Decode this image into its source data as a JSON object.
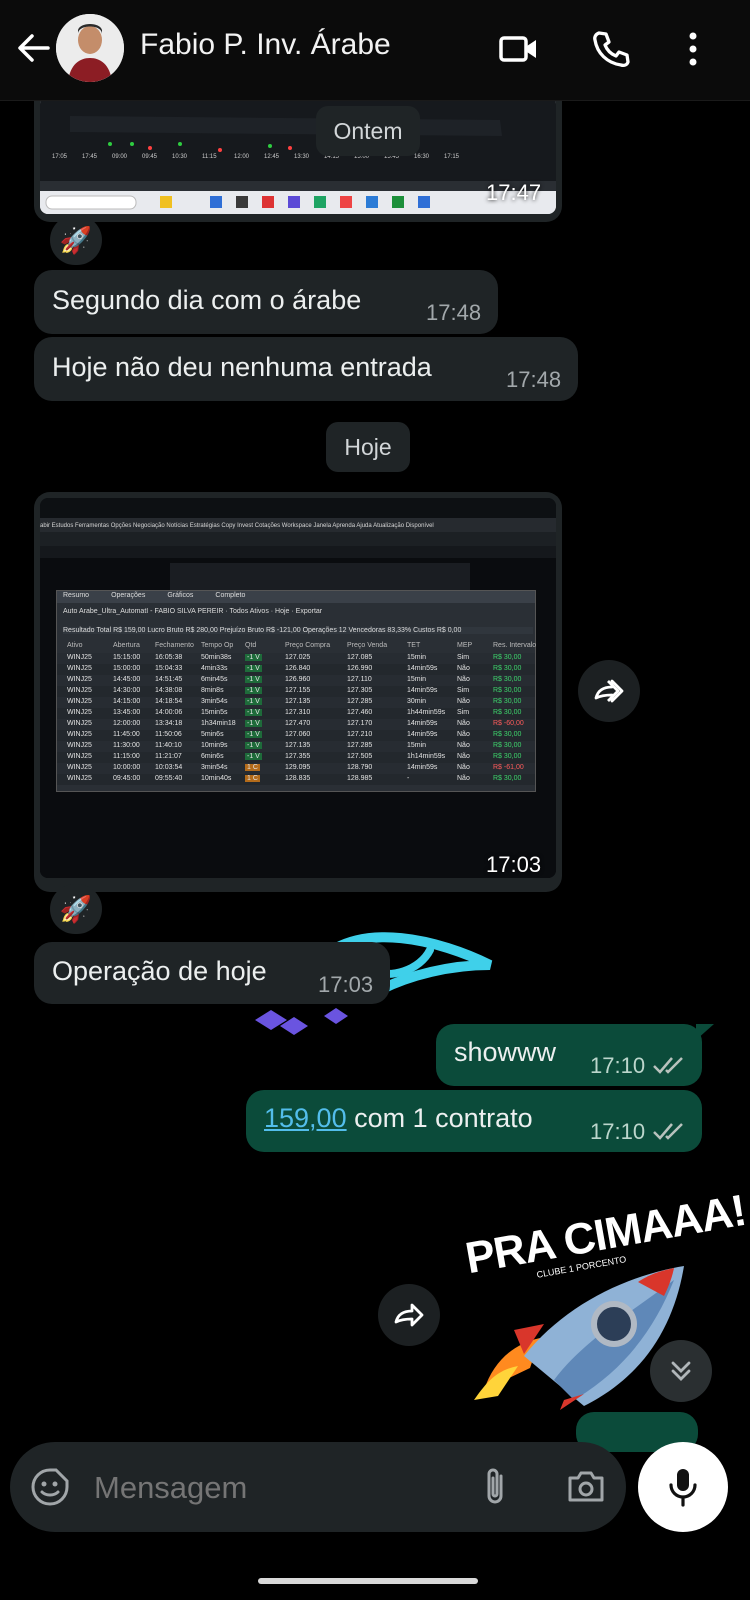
{
  "header": {
    "contact_name": "Fabio P. Inv. Árabe",
    "back_icon": "arrow-left-icon",
    "video_icon": "video-call-icon",
    "call_icon": "phone-icon",
    "menu_icon": "more-vertical-icon"
  },
  "chat": {
    "top_image_time": "17:47",
    "date_divider_yesterday": "Ontem",
    "reaction_1": "🚀",
    "msg1": {
      "text": "Segundo dia com o árabe",
      "time": "17:48"
    },
    "msg2": {
      "text": "Hoje não deu nenhuma entrada",
      "time": "17:48"
    },
    "date_divider_today": "Hoje",
    "image2_time": "17:03",
    "reaction_2": "🚀",
    "msg3": {
      "text": "Operação de hoje",
      "time": "17:03"
    },
    "out1": {
      "text": "showww",
      "time": "17:10"
    },
    "out2": {
      "link": "159,00",
      "text": " com 1 contrato",
      "time": "17:10"
    },
    "sticker": {
      "headline": "PRA CIMAAA!",
      "sub": "CLUBE 1 PORCENTO"
    }
  },
  "screenshot_table": {
    "menu": "abir  Estudos  Ferramentas  Opções  Negociação  Notícias  Estratégias  Copy Invest  Cotações  Workspace  Janela  Aprenda  Ajuda  Atualização Disponível",
    "tabs": [
      "Resumo",
      "Operações",
      "Gráficos",
      "Completo"
    ],
    "filter": "Auto  Arabe_Ultra_AutomatI - FABIO SILVA PEREIR  ·  Todos Ativos  ·  Hoje  ·  Exportar",
    "summary": "Resultado Total R$ 159,00   Lucro Bruto R$ 280,00   Prejuízo Bruto R$ -121,00   Operações 12   Vencedoras 83,33%   Custos R$ 0,00",
    "columns": [
      "Ativo",
      "Abertura",
      "Fechamento",
      "Tempo Op",
      "Qtd",
      "Preço Compra",
      "Preço Venda",
      "TET",
      "MEP",
      "Res. Intervalo"
    ],
    "rows": [
      [
        "WINJ25",
        "15:15:00",
        "16:05:38",
        "50min38s",
        "-1 V",
        "127.025",
        "127.085",
        "15min",
        "Sim",
        "R$ 30,00"
      ],
      [
        "WINJ25",
        "15:00:00",
        "15:04:33",
        "4min33s",
        "-1 V",
        "126.840",
        "126.990",
        "14min59s",
        "Não",
        "R$ 30,00"
      ],
      [
        "WINJ25",
        "14:45:00",
        "14:51:45",
        "6min45s",
        "-1 V",
        "126.960",
        "127.110",
        "15min",
        "Não",
        "R$ 30,00"
      ],
      [
        "WINJ25",
        "14:30:00",
        "14:38:08",
        "8min8s",
        "-1 V",
        "127.155",
        "127.305",
        "14min59s",
        "Sim",
        "R$ 30,00"
      ],
      [
        "WINJ25",
        "14:15:00",
        "14:18:54",
        "3min54s",
        "-1 V",
        "127.135",
        "127.285",
        "30min",
        "Não",
        "R$ 30,00"
      ],
      [
        "WINJ25",
        "13:45:00",
        "14:00:06",
        "15min5s",
        "-1 V",
        "127.310",
        "127.460",
        "1h44min59s",
        "Sim",
        "R$ 30,00"
      ],
      [
        "WINJ25",
        "12:00:00",
        "13:34:18",
        "1h34min18",
        "-1 V",
        "127.470",
        "127.170",
        "14min59s",
        "Não",
        "R$ -60,00"
      ],
      [
        "WINJ25",
        "11:45:00",
        "11:50:06",
        "5min6s",
        "-1 V",
        "127.060",
        "127.210",
        "14min59s",
        "Não",
        "R$ 30,00"
      ],
      [
        "WINJ25",
        "11:30:00",
        "11:40:10",
        "10min9s",
        "-1 V",
        "127.135",
        "127.285",
        "15min",
        "Não",
        "R$ 30,00"
      ],
      [
        "WINJ25",
        "11:15:00",
        "11:21:07",
        "6min6s",
        "-1 V",
        "127.355",
        "127.505",
        "1h14min59s",
        "Não",
        "R$ 30,00"
      ],
      [
        "WINJ25",
        "10:00:00",
        "10:03:54",
        "3min54s",
        "1 C",
        "129.095",
        "128.790",
        "14min59s",
        "Não",
        "R$ -61,00"
      ],
      [
        "WINJ25",
        "09:45:00",
        "09:55:40",
        "10min40s",
        "1 C",
        "128.835",
        "128.985",
        "-",
        "Não",
        "R$ 30,00"
      ]
    ]
  },
  "input": {
    "placeholder": "Mensagem",
    "emoji_icon": "sticker-smile-icon",
    "attach_icon": "paperclip-icon",
    "camera_icon": "camera-icon",
    "mic_icon": "microphone-icon"
  },
  "colors": {
    "incoming": "#1f2426",
    "outgoing": "#0b4b3a",
    "link": "#53bdeb"
  }
}
